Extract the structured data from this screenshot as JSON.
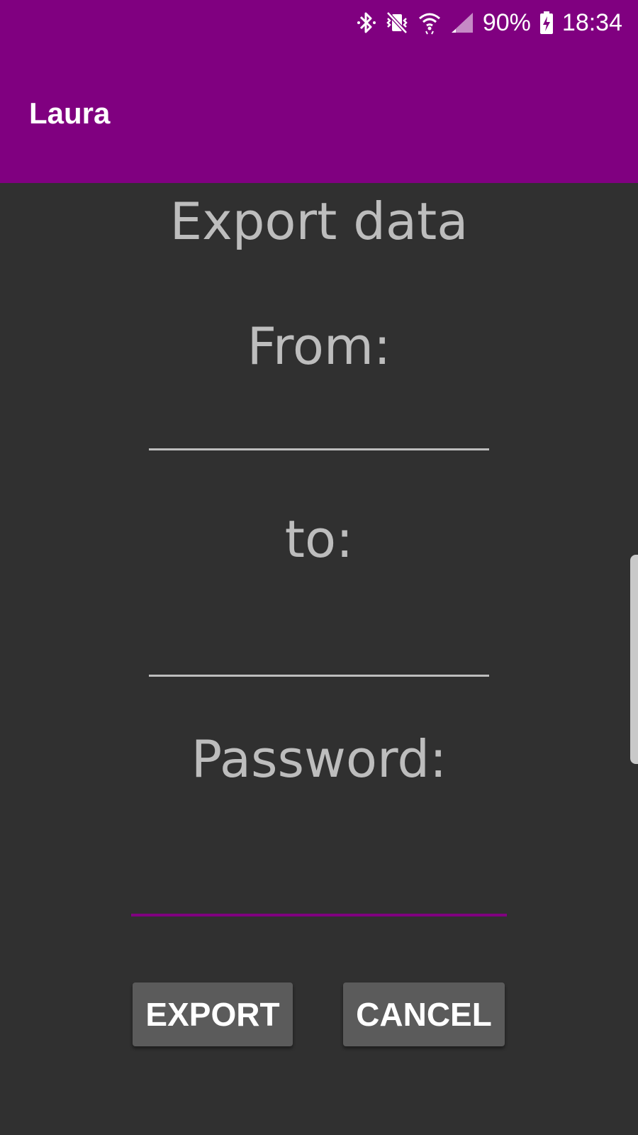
{
  "status_bar": {
    "battery": "90%",
    "time": "18:34",
    "icons": [
      "bluetooth-icon",
      "vibrate-mute-icon",
      "wifi-icon",
      "cell-signal-icon",
      "battery-charging-icon"
    ]
  },
  "app_bar": {
    "title": "Laura",
    "color": "#800080"
  },
  "form": {
    "heading": "Export data",
    "from_label": "From:",
    "from_value": "",
    "to_label": "to:",
    "to_value": "",
    "password_label": "Password:",
    "password_value": "",
    "password_focused": true
  },
  "buttons": {
    "export_label": "EXPORT",
    "cancel_label": "CANCEL"
  },
  "colors": {
    "background": "#303030",
    "accent": "#800080",
    "label_text": "#bdbdbd",
    "button_bg": "#5b5b5b"
  }
}
